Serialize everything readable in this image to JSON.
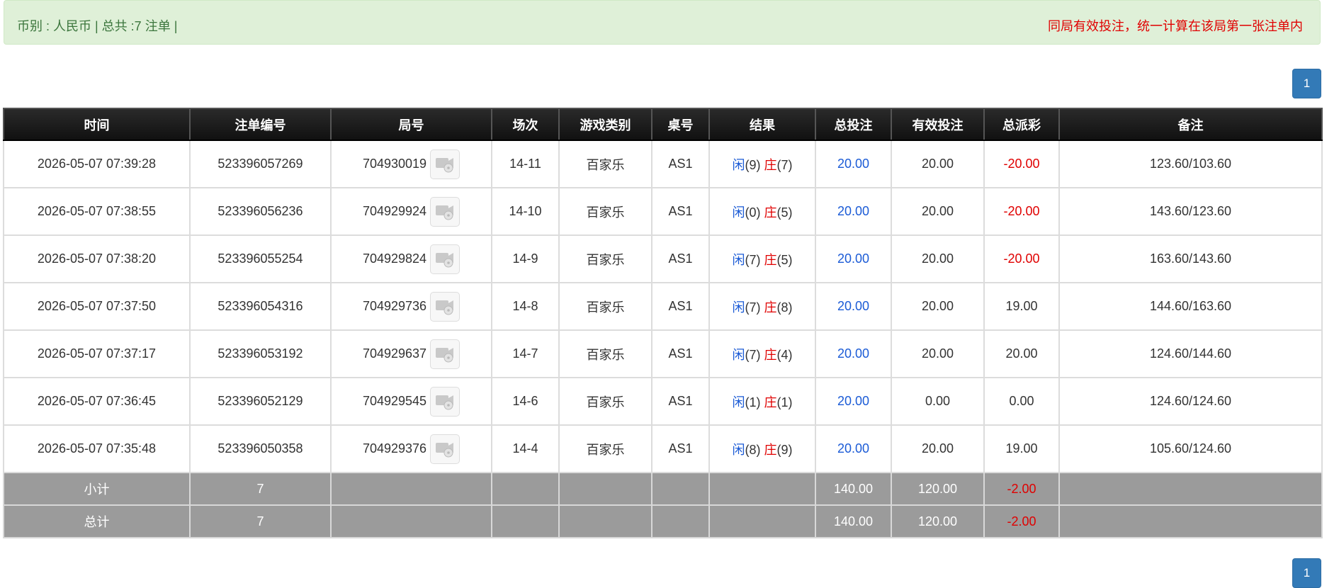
{
  "alert": {
    "left_text": "币别 : 人民币 | 总共 :7 注单 |",
    "right_text": "同局有效投注，统一计算在该局第一张注单内"
  },
  "pagination": {
    "current_page": "1"
  },
  "table": {
    "headers": [
      "时间",
      "注单编号",
      "局号",
      "场次",
      "游戏类别",
      "桌号",
      "结果",
      "总投注",
      "有效投注",
      "总派彩",
      "备注"
    ],
    "rows": [
      {
        "time": "2026-05-07 07:39:28",
        "bet_id": "523396057269",
        "round": "704930019",
        "session": "14-11",
        "game": "百家乐",
        "table_no": "AS1",
        "player_label": "闲",
        "player_score": "(9)",
        "banker_label": "庄",
        "banker_score": "(7)",
        "total_bet": "20.00",
        "valid_bet": "20.00",
        "payout": "-20.00",
        "payout_neg": true,
        "note": "123.60/103.60"
      },
      {
        "time": "2026-05-07 07:38:55",
        "bet_id": "523396056236",
        "round": "704929924",
        "session": "14-10",
        "game": "百家乐",
        "table_no": "AS1",
        "player_label": "闲",
        "player_score": "(0)",
        "banker_label": "庄",
        "banker_score": "(5)",
        "total_bet": "20.00",
        "valid_bet": "20.00",
        "payout": "-20.00",
        "payout_neg": true,
        "note": "143.60/123.60"
      },
      {
        "time": "2026-05-07 07:38:20",
        "bet_id": "523396055254",
        "round": "704929824",
        "session": "14-9",
        "game": "百家乐",
        "table_no": "AS1",
        "player_label": "闲",
        "player_score": "(7)",
        "banker_label": "庄",
        "banker_score": "(5)",
        "total_bet": "20.00",
        "valid_bet": "20.00",
        "payout": "-20.00",
        "payout_neg": true,
        "note": "163.60/143.60"
      },
      {
        "time": "2026-05-07 07:37:50",
        "bet_id": "523396054316",
        "round": "704929736",
        "session": "14-8",
        "game": "百家乐",
        "table_no": "AS1",
        "player_label": "闲",
        "player_score": "(7)",
        "banker_label": "庄",
        "banker_score": "(8)",
        "total_bet": "20.00",
        "valid_bet": "20.00",
        "payout": "19.00",
        "payout_neg": false,
        "note": "144.60/163.60"
      },
      {
        "time": "2026-05-07 07:37:17",
        "bet_id": "523396053192",
        "round": "704929637",
        "session": "14-7",
        "game": "百家乐",
        "table_no": "AS1",
        "player_label": "闲",
        "player_score": "(7)",
        "banker_label": "庄",
        "banker_score": "(4)",
        "total_bet": "20.00",
        "valid_bet": "20.00",
        "payout": "20.00",
        "payout_neg": false,
        "note": "124.60/144.60"
      },
      {
        "time": "2026-05-07 07:36:45",
        "bet_id": "523396052129",
        "round": "704929545",
        "session": "14-6",
        "game": "百家乐",
        "table_no": "AS1",
        "player_label": "闲",
        "player_score": "(1)",
        "banker_label": "庄",
        "banker_score": "(1)",
        "total_bet": "20.00",
        "valid_bet": "0.00",
        "payout": "0.00",
        "payout_neg": false,
        "note": "124.60/124.60"
      },
      {
        "time": "2026-05-07 07:35:48",
        "bet_id": "523396050358",
        "round": "704929376",
        "session": "14-4",
        "game": "百家乐",
        "table_no": "AS1",
        "player_label": "闲",
        "player_score": "(8)",
        "banker_label": "庄",
        "banker_score": "(9)",
        "total_bet": "20.00",
        "valid_bet": "20.00",
        "payout": "19.00",
        "payout_neg": false,
        "note": "105.60/124.60"
      }
    ],
    "subtotal": {
      "label": "小计",
      "count": "7",
      "total_bet": "140.00",
      "valid_bet": "120.00",
      "payout": "-2.00"
    },
    "total": {
      "label": "总计",
      "count": "7",
      "total_bet": "140.00",
      "valid_bet": "120.00",
      "payout": "-2.00"
    }
  },
  "colors": {
    "alert_bg": "#dff0d8",
    "alert_text": "#3c763d",
    "warning_text": "#e00000",
    "header_bg": "#1a1a1a",
    "link_blue": "#1b5bd6",
    "negative_red": "#e00000",
    "footer_bg": "#9b9b9b",
    "page_btn": "#337ab7"
  },
  "icons": {
    "replay": "video-replay-icon"
  }
}
